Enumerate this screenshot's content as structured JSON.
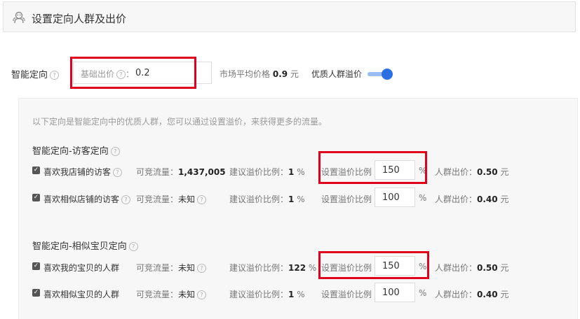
{
  "header": {
    "title": "设置定向人群及出价",
    "icon": "people-group-icon"
  },
  "smart": {
    "label": "智能定向",
    "base_bid_label": "基础出价",
    "base_bid_colon": "：",
    "base_bid_value": "0.2",
    "market_avg_label": "市场平均价格",
    "market_avg_value": "0.9",
    "market_avg_unit": "元",
    "premium_label": "优质人群溢价",
    "premium_enabled": true
  },
  "panel": {
    "intro": "以下定向是智能定向中的优质人群，您可以通过设置溢价，来获得更多的流量。",
    "traffic_label": "可竞流量：",
    "suggest_label": "建议溢价比例：",
    "set_label": "设置溢价比例",
    "pct_unit": "%",
    "bid_label": "人群出价：",
    "bid_unit": "元",
    "groups": [
      {
        "title": "智能定向-访客定向",
        "rows": [
          {
            "name": "喜欢我店铺的访客",
            "checked": true,
            "traffic": "1,437,005",
            "suggest": "1",
            "pct": "150",
            "bid": "0.50"
          },
          {
            "name": "喜欢相似店铺的访客",
            "checked": true,
            "traffic": "未知",
            "suggest": "1",
            "pct": "100",
            "bid": "0.40"
          }
        ]
      },
      {
        "title": "智能定向-相似宝贝定向",
        "rows": [
          {
            "name": "喜欢我的宝贝的人群",
            "checked": true,
            "traffic": "未知",
            "suggest": "122",
            "pct": "150",
            "bid": "0.50"
          },
          {
            "name": "喜欢相似宝贝的人群",
            "checked": true,
            "traffic": "未知",
            "suggest": "1",
            "pct": "100",
            "bid": "0.40"
          }
        ]
      }
    ]
  },
  "colors": {
    "highlight": "#e0001b",
    "toggle_on": "#2f6fe4",
    "panel_bg": "#f7f7f7"
  }
}
